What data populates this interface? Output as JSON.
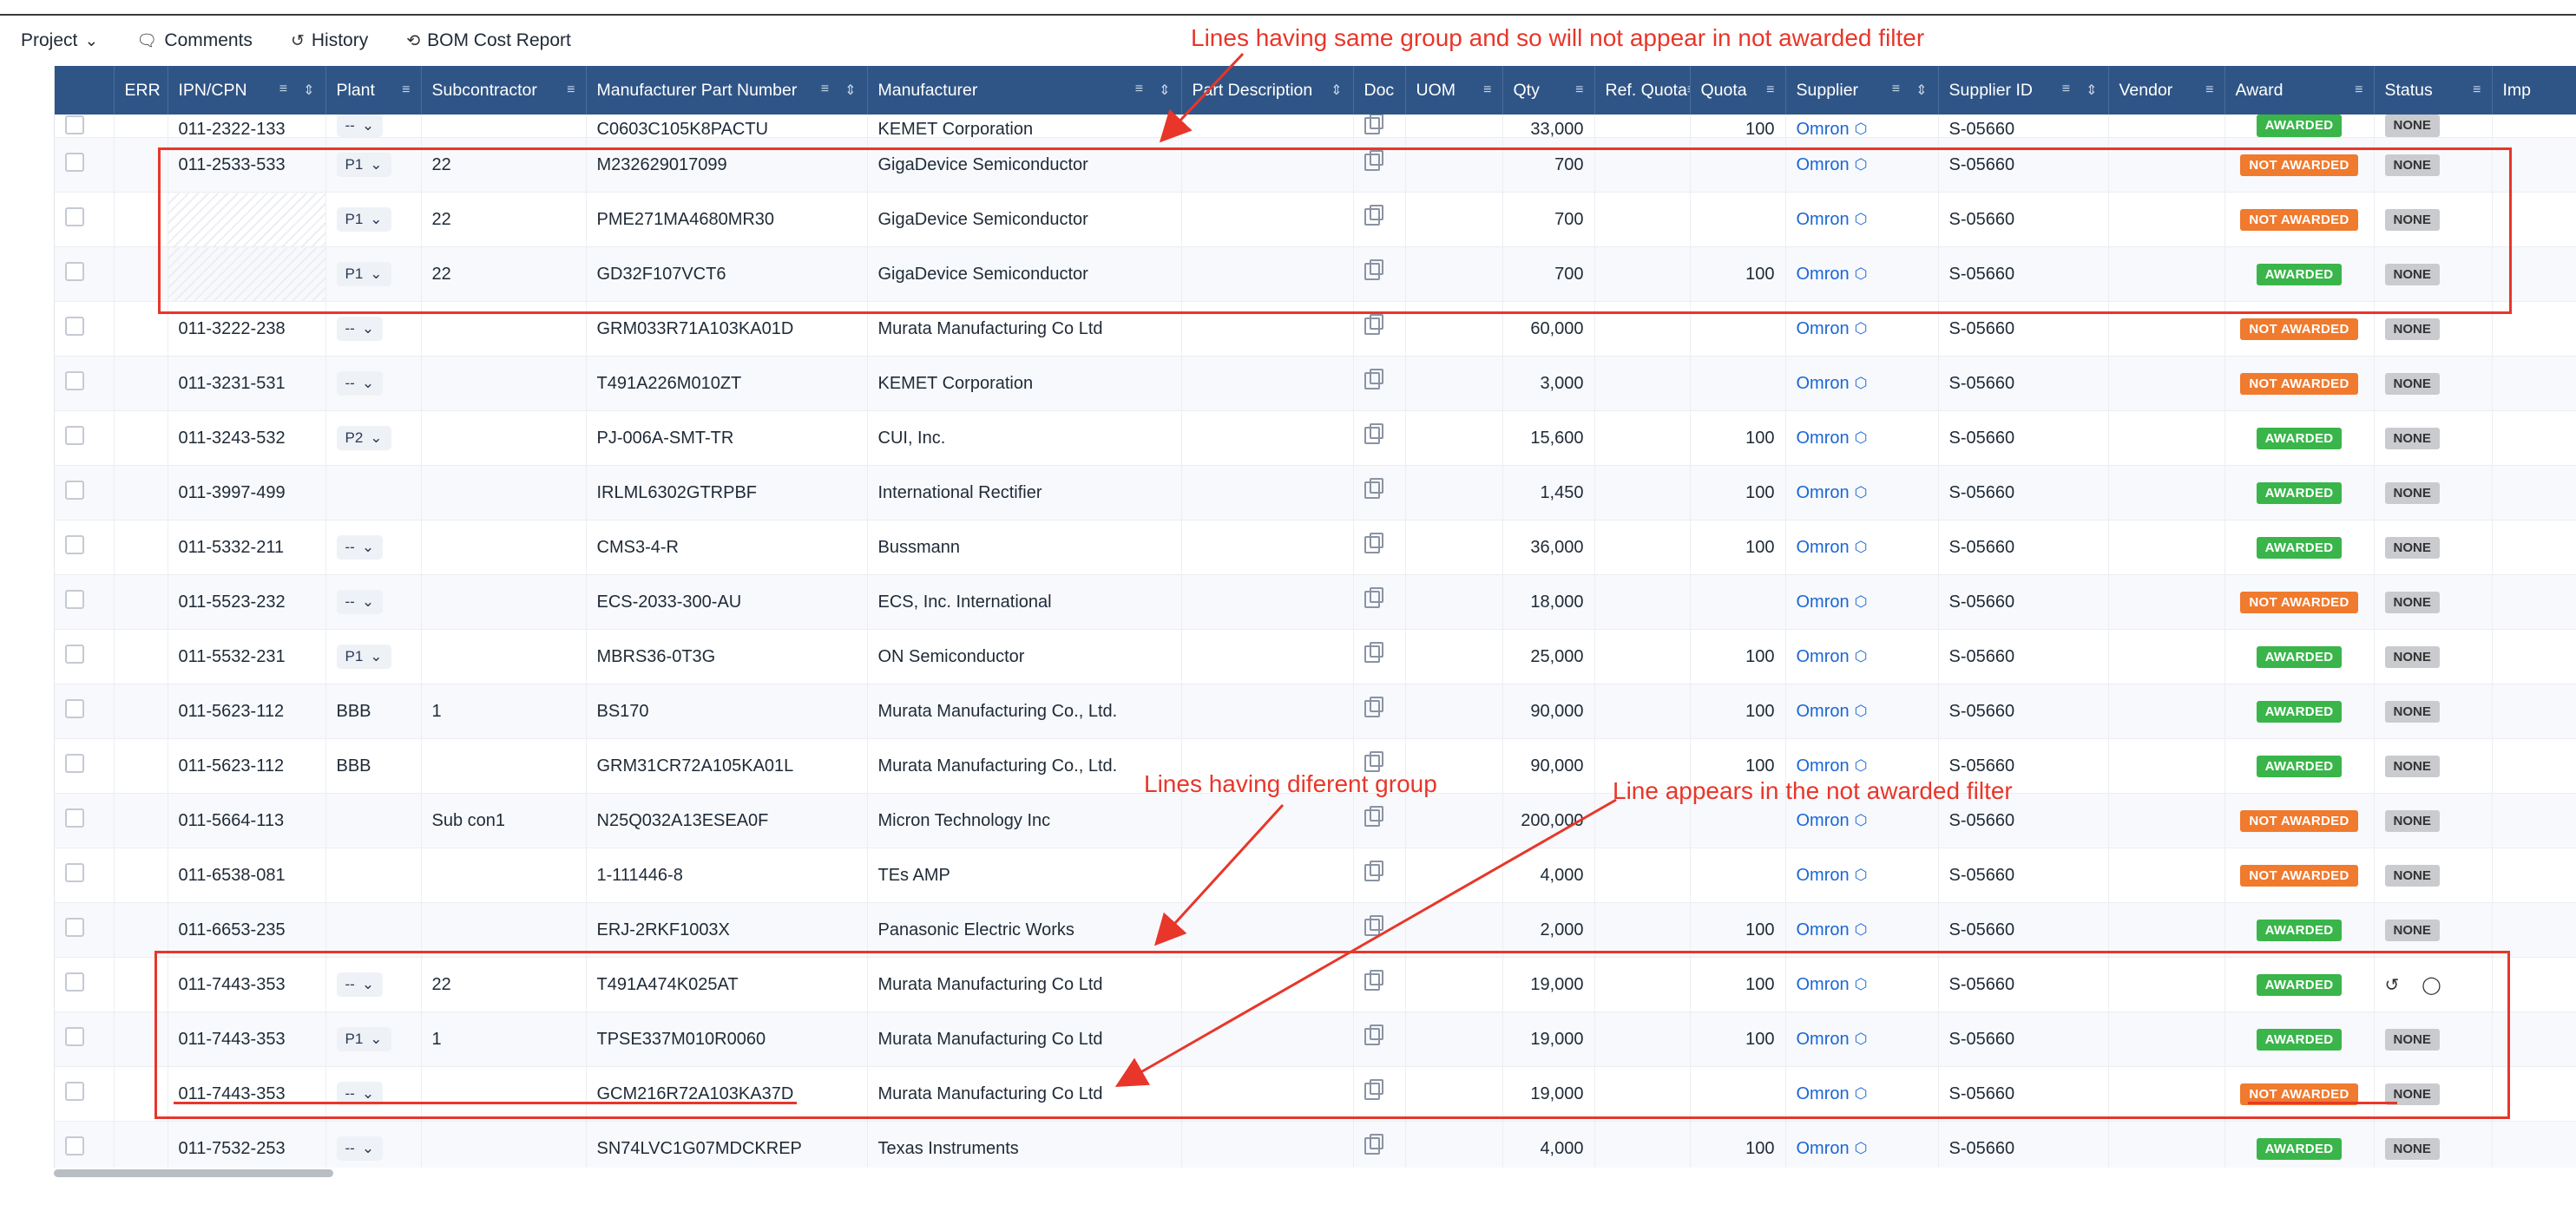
{
  "toolbar": {
    "project": "Project",
    "comments": "Comments",
    "history": "History",
    "bom_cost_report": "BOM Cost Report"
  },
  "columns": [
    "ERR",
    "IPN/CPN",
    "Plant",
    "Subcontractor",
    "Manufacturer Part Number",
    "Manufacturer",
    "Part Description",
    "Doc",
    "UOM",
    "Qty",
    "Ref. Quota",
    "Quota",
    "Supplier",
    "Supplier ID",
    "Vendor",
    "Award",
    "Status",
    "Imp"
  ],
  "rows": [
    {
      "ipn": "011-2322-133",
      "plant": "--",
      "sub": "",
      "mpn": "C0603C105K8PACTU",
      "mfr": "KEMET Corporation",
      "qty": "33,000",
      "quota": "100",
      "supplier": "Omron",
      "sid": "S-05660",
      "award": "AWARDED",
      "status": "NONE"
    },
    {
      "ipn": "011-2533-533",
      "plant": "P1",
      "sub": "22",
      "mpn": "M232629017099",
      "mfr": "GigaDevice Semiconductor",
      "qty": "700",
      "quota": "",
      "supplier": "Omron",
      "sid": "S-05660",
      "award": "NOT AWARDED",
      "status": "NONE"
    },
    {
      "ipn": "",
      "plant": "P1",
      "sub": "22",
      "mpn": "PME271MA4680MR30",
      "mfr": "GigaDevice Semiconductor",
      "qty": "700",
      "quota": "",
      "supplier": "Omron",
      "sid": "S-05660",
      "award": "NOT AWARDED",
      "status": "NONE"
    },
    {
      "ipn": "",
      "plant": "P1",
      "sub": "22",
      "mpn": "GD32F107VCT6",
      "mfr": "GigaDevice Semiconductor",
      "qty": "700",
      "quota": "100",
      "supplier": "Omron",
      "sid": "S-05660",
      "award": "AWARDED",
      "status": "NONE"
    },
    {
      "ipn": "011-3222-238",
      "plant": "--",
      "sub": "",
      "mpn": "GRM033R71A103KA01D",
      "mfr": "Murata Manufacturing Co Ltd",
      "qty": "60,000",
      "quota": "",
      "supplier": "Omron",
      "sid": "S-05660",
      "award": "NOT AWARDED",
      "status": "NONE"
    },
    {
      "ipn": "011-3231-531",
      "plant": "--",
      "sub": "",
      "mpn": "T491A226M010ZT",
      "mfr": "KEMET Corporation",
      "qty": "3,000",
      "quota": "",
      "supplier": "Omron",
      "sid": "S-05660",
      "award": "NOT AWARDED",
      "status": "NONE"
    },
    {
      "ipn": "011-3243-532",
      "plant": "P2",
      "sub": "",
      "mpn": "PJ-006A-SMT-TR",
      "mfr": "CUI, Inc.",
      "qty": "15,600",
      "quota": "100",
      "supplier": "Omron",
      "sid": "S-05660",
      "award": "AWARDED",
      "status": "NONE"
    },
    {
      "ipn": "011-3997-499",
      "plant": "",
      "sub": "",
      "mpn": "IRLML6302GTRPBF",
      "mfr": "International Rectifier",
      "qty": "1,450",
      "quota": "100",
      "supplier": "Omron",
      "sid": "S-05660",
      "award": "AWARDED",
      "status": "NONE"
    },
    {
      "ipn": "011-5332-211",
      "plant": "--",
      "sub": "",
      "mpn": "CMS3-4-R",
      "mfr": "Bussmann",
      "qty": "36,000",
      "quota": "100",
      "supplier": "Omron",
      "sid": "S-05660",
      "award": "AWARDED",
      "status": "NONE"
    },
    {
      "ipn": "011-5523-232",
      "plant": "--",
      "sub": "",
      "mpn": "ECS-2033-300-AU",
      "mfr": "ECS, Inc. International",
      "qty": "18,000",
      "quota": "",
      "supplier": "Omron",
      "sid": "S-05660",
      "award": "NOT AWARDED",
      "status": "NONE"
    },
    {
      "ipn": "011-5532-231",
      "plant": "P1",
      "sub": "",
      "mpn": "MBRS36-0T3G",
      "mfr": "ON Semiconductor",
      "qty": "25,000",
      "quota": "100",
      "supplier": "Omron",
      "sid": "S-05660",
      "award": "AWARDED",
      "status": "NONE"
    },
    {
      "ipn": "011-5623-112",
      "plant": "BBB",
      "sub": "1",
      "mpn": "BS170",
      "mfr": "Murata Manufacturing Co., Ltd.",
      "qty": "90,000",
      "quota": "100",
      "supplier": "Omron",
      "sid": "S-05660",
      "award": "AWARDED",
      "status": "NONE"
    },
    {
      "ipn": "011-5623-112",
      "plant": "BBB",
      "sub": "",
      "mpn": "GRM31CR72A105KA01L",
      "mfr": "Murata Manufacturing Co., Ltd.",
      "qty": "90,000",
      "quota": "100",
      "supplier": "Omron",
      "sid": "S-05660",
      "award": "AWARDED",
      "status": "NONE"
    },
    {
      "ipn": "011-5664-113",
      "plant": "",
      "sub": "Sub con1",
      "mpn": "N25Q032A13ESEA0F",
      "mfr": "Micron Technology Inc",
      "qty": "200,000",
      "quota": "",
      "supplier": "Omron",
      "sid": "S-05660",
      "award": "NOT AWARDED",
      "status": "NONE"
    },
    {
      "ipn": "011-6538-081",
      "plant": "",
      "sub": "",
      "mpn": "1-111446-8",
      "mfr": "TEs AMP",
      "qty": "4,000",
      "quota": "",
      "supplier": "Omron",
      "sid": "S-05660",
      "award": "NOT AWARDED",
      "status": "NONE"
    },
    {
      "ipn": "011-6653-235",
      "plant": "",
      "sub": "",
      "mpn": "ERJ-2RKF1003X",
      "mfr": "Panasonic Electric Works",
      "qty": "2,000",
      "quota": "100",
      "supplier": "Omron",
      "sid": "S-05660",
      "award": "AWARDED",
      "status": "NONE"
    },
    {
      "ipn": "011-7443-353",
      "plant": "--",
      "sub": "22",
      "mpn": "T491A474K025AT",
      "mfr": "Murata Manufacturing Co Ltd",
      "qty": "19,000",
      "quota": "100",
      "supplier": "Omron",
      "sid": "S-05660",
      "award": "AWARDED",
      "status": ""
    },
    {
      "ipn": "011-7443-353",
      "plant": "P1",
      "sub": "1",
      "mpn": "TPSE337M010R0060",
      "mfr": "Murata Manufacturing Co Ltd",
      "qty": "19,000",
      "quota": "100",
      "supplier": "Omron",
      "sid": "S-05660",
      "award": "AWARDED",
      "status": "NONE"
    },
    {
      "ipn": "011-7443-353",
      "plant": "--",
      "sub": "",
      "mpn": "GCM216R72A103KA37D",
      "mfr": "Murata Manufacturing Co Ltd",
      "qty": "19,000",
      "quota": "",
      "supplier": "Omron",
      "sid": "S-05660",
      "award": "NOT AWARDED",
      "status": "NONE"
    },
    {
      "ipn": "011-7532-253",
      "plant": "--",
      "sub": "",
      "mpn": "SN74LVC1G07MDCKREP",
      "mfr": "Texas Instruments",
      "qty": "4,000",
      "quota": "100",
      "supplier": "Omron",
      "sid": "S-05660",
      "award": "AWARDED",
      "status": "NONE"
    }
  ],
  "annotations": {
    "same_group": "Lines having same group and so will not appear in not awarded filter",
    "different_group": "Lines having diferent group",
    "appears_filter": "Line appears in the not awarded filter"
  },
  "colors": {
    "header_bg": "#2f5586",
    "awarded": "#39b54a",
    "not_awarded": "#f07a2e",
    "annotation": "#e8362a",
    "link": "#1a66d6"
  }
}
